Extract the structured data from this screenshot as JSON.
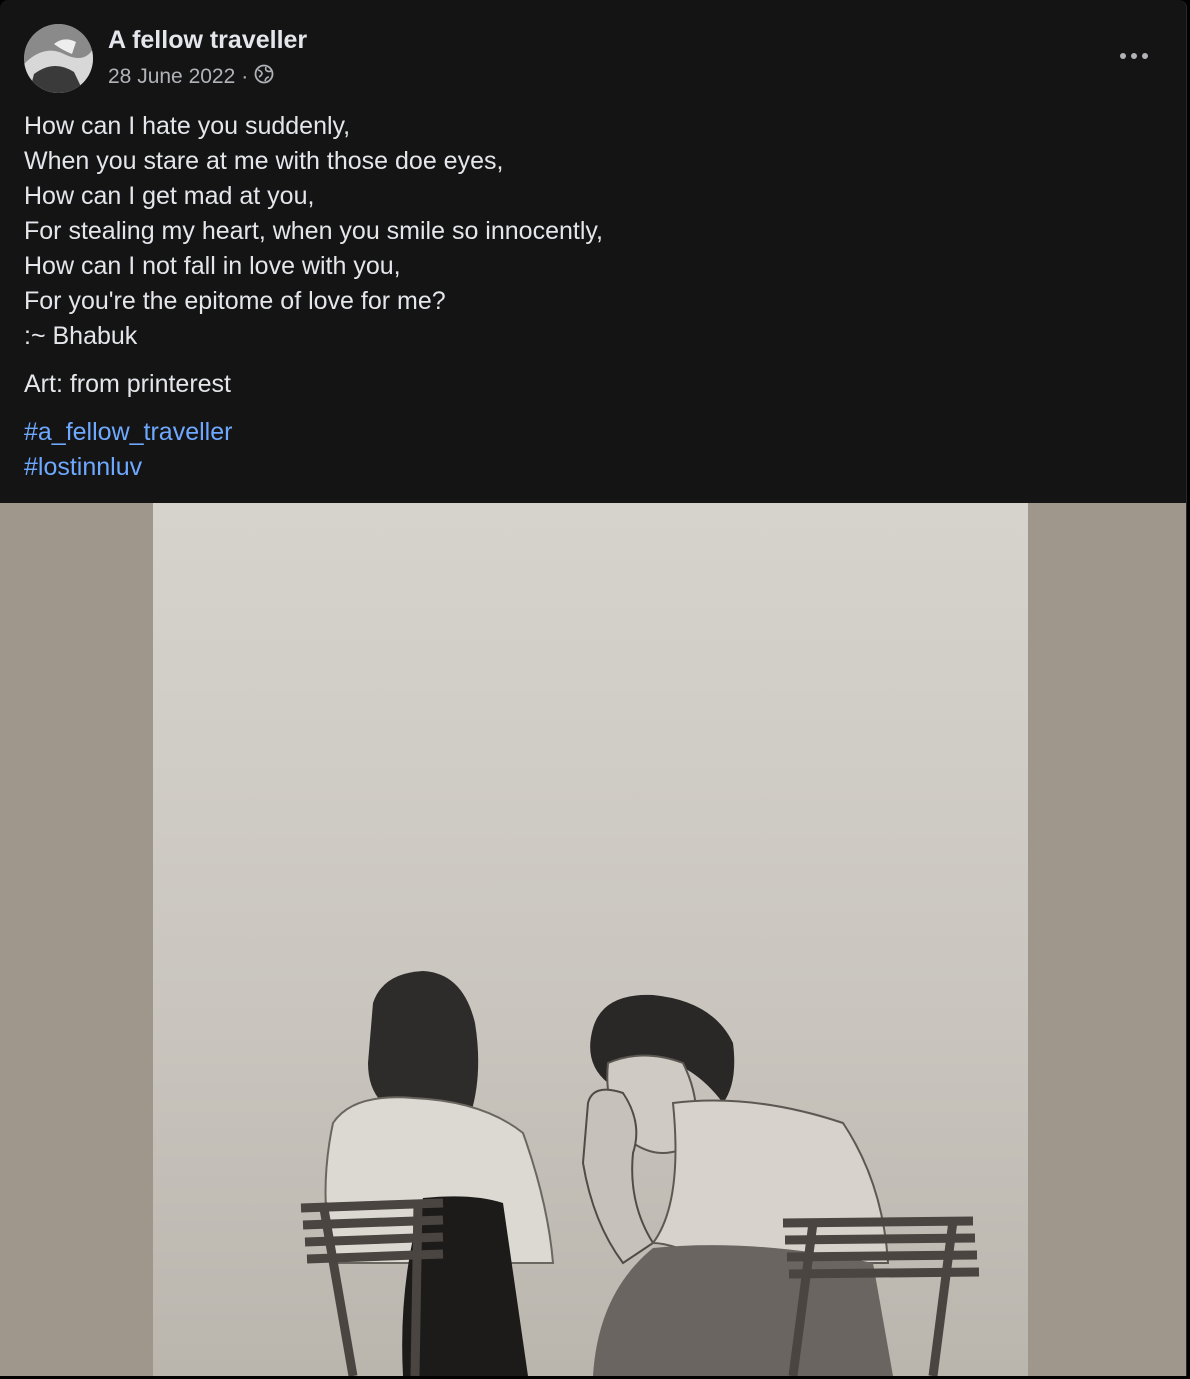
{
  "post": {
    "author": "A fellow traveller",
    "date": "28 June 2022",
    "separator": "·",
    "audience_icon": "globe-icon",
    "more_icon": "more-options-icon",
    "poem_lines": [
      "How can I hate you suddenly,",
      "When you stare at me with those doe eyes,",
      "How can I get mad at you,",
      "For stealing my heart, when you smile so innocently,",
      "How can I not fall in love with you,",
      "For you're the epitome of love for me?",
      ":~ Bhabuk"
    ],
    "art_credit": "Art: from printerest",
    "hashtags": [
      "#a_fellow_traveller",
      "#lostinnluv"
    ]
  },
  "colors": {
    "background": "#141414",
    "text": "#e4e6eb",
    "secondary_text": "#b0b3b8",
    "link": "#6ea8ff",
    "media_backdrop": "#a0978c"
  }
}
